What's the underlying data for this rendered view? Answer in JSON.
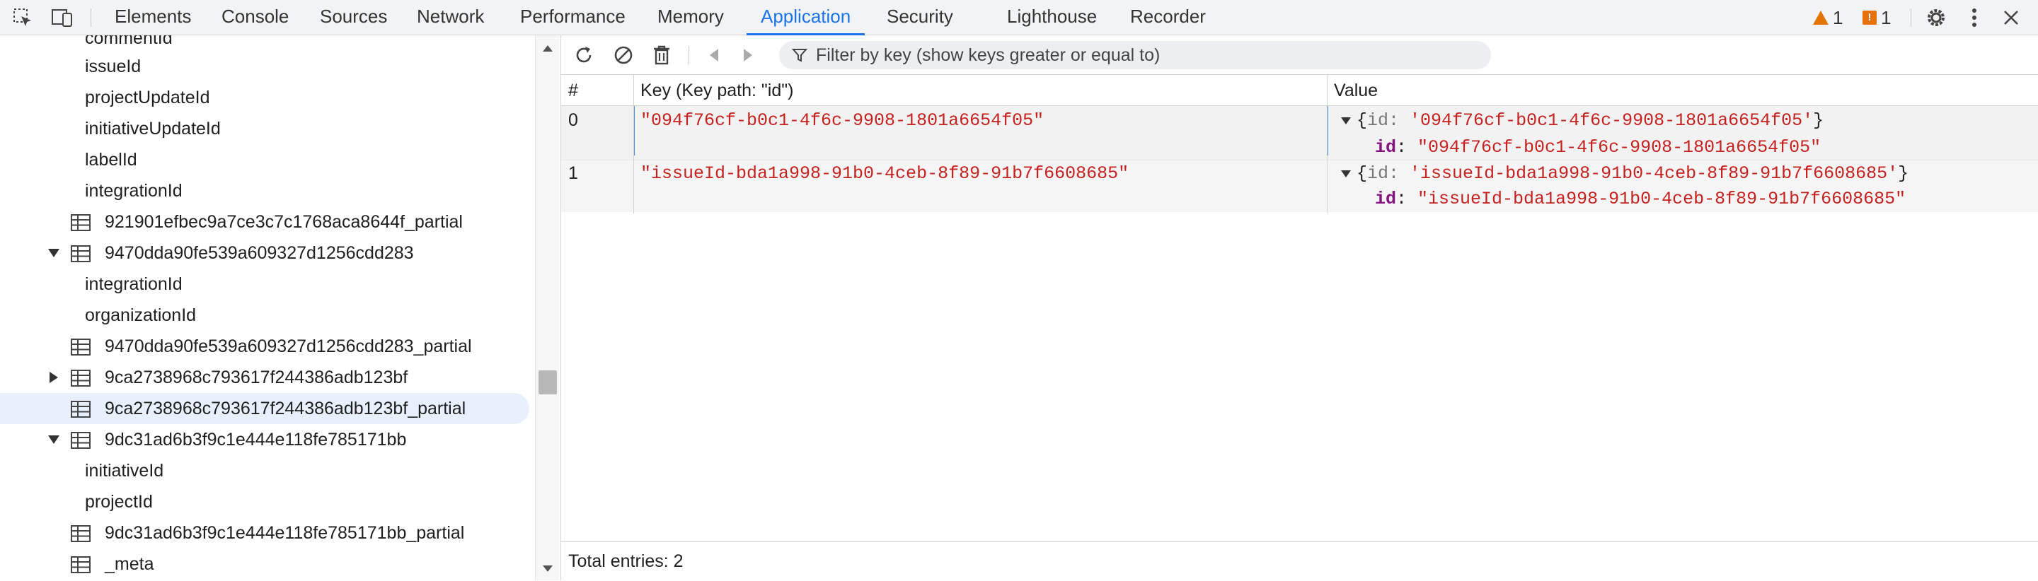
{
  "toolbar": {
    "tabs": [
      "Elements",
      "Console",
      "Sources",
      "Network",
      "Performance",
      "Memory",
      "Application",
      "Security",
      "Lighthouse",
      "Recorder"
    ],
    "active_tab": "Application",
    "warnings_count": "1",
    "issues_count": "1"
  },
  "sidebar": {
    "items": [
      {
        "label": "commentId",
        "type": "index"
      },
      {
        "label": "issueId",
        "type": "index"
      },
      {
        "label": "projectUpdateId",
        "type": "index"
      },
      {
        "label": "initiativeUpdateId",
        "type": "index"
      },
      {
        "label": "labelId",
        "type": "index"
      },
      {
        "label": "integrationId",
        "type": "index"
      },
      {
        "label": "921901efbec9a7ce3c7c1768aca8644f_partial",
        "type": "store"
      },
      {
        "label": "9470dda90fe539a609327d1256cdd283",
        "type": "store-expanded"
      },
      {
        "label": "integrationId",
        "type": "index"
      },
      {
        "label": "organizationId",
        "type": "index"
      },
      {
        "label": "9470dda90fe539a609327d1256cdd283_partial",
        "type": "store"
      },
      {
        "label": "9ca2738968c793617f244386adb123bf",
        "type": "store-collapsed"
      },
      {
        "label": "9ca2738968c793617f244386adb123bf_partial",
        "type": "store-selected"
      },
      {
        "label": "9dc31ad6b3f9c1e444e118fe785171bb",
        "type": "store-expanded"
      },
      {
        "label": "initiativeId",
        "type": "index"
      },
      {
        "label": "projectId",
        "type": "index"
      },
      {
        "label": "9dc31ad6b3f9c1e444e118fe785171bb_partial",
        "type": "store"
      },
      {
        "label": "_meta",
        "type": "store"
      }
    ]
  },
  "data_view": {
    "filter_placeholder": "Filter by key (show keys greater or equal to)",
    "columns": {
      "num": "#",
      "key": "Key (Key path: \"id\")",
      "value": "Value"
    },
    "rows": [
      {
        "num": "0",
        "key": "\"094f76cf-b0c1-4f6c-9908-1801a6654f05\"",
        "value_summary_key": "id",
        "value_summary_val": "'094f76cf-b0c1-4f6c-9908-1801a6654f05'",
        "value_prop_key": "id",
        "value_prop_val": "\"094f76cf-b0c1-4f6c-9908-1801a6654f05\""
      },
      {
        "num": "1",
        "key": "\"issueId-bda1a998-91b0-4ceb-8f89-91b7f6608685\"",
        "value_summary_key": "id",
        "value_summary_val": "'issueId-bda1a998-91b0-4ceb-8f89-91b7f6608685'",
        "value_prop_key": "id",
        "value_prop_val": "\"issueId-bda1a998-91b0-4ceb-8f89-91b7f6608685\""
      }
    ],
    "footer": "Total entries: 2"
  }
}
